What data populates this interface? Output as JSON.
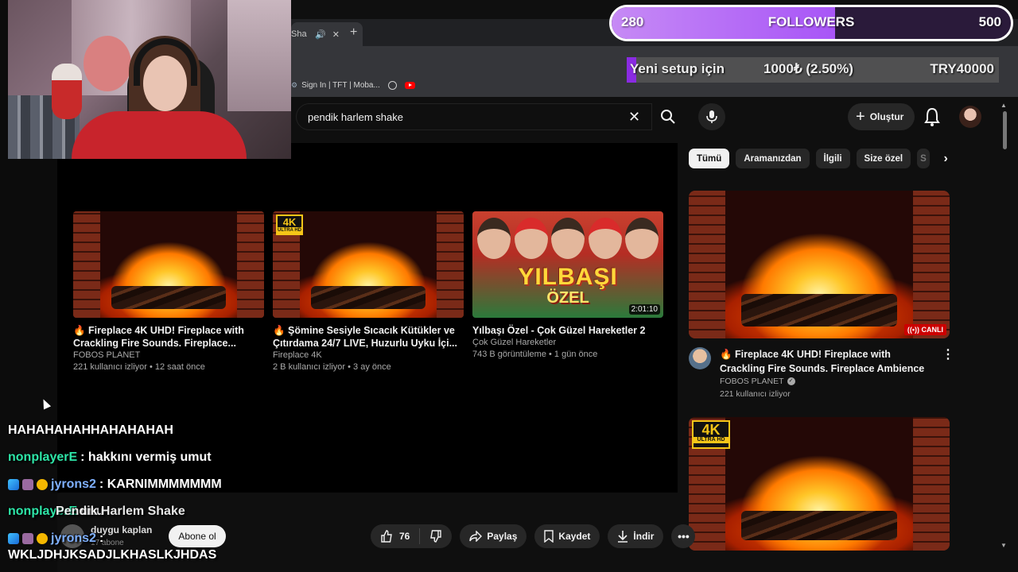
{
  "browser": {
    "tab_title": "Sha",
    "new_tab": "+",
    "bookmarks": [
      {
        "label": "Sign In | TFT | Moba..."
      }
    ]
  },
  "youtube": {
    "search_value": "pendik harlem shake",
    "create_label": "Oluştur",
    "chips": [
      "Tümü",
      "Aramanızdan",
      "İlgili",
      "Size özel",
      "S"
    ],
    "endcards": [
      {
        "title": "🔥 Fireplace 4K UHD! Fireplace with Crackling Fire Sounds. Fireplace...",
        "channel": "FOBOS PLANET",
        "meta": "221 kullanıcı izliyor • 12 saat önce"
      },
      {
        "title": "🔥 Şömine Sesiyle Sıcacık Kütükler ve Çıtırdama 24/7 LIVE, Huzurlu Uyku İçi...",
        "channel": "Fireplace 4K",
        "meta": "2 B kullanıcı izliyor • 3 ay önce",
        "badge_top": "4K",
        "badge_bottom": "ULTRA HD"
      },
      {
        "title": "Yılbaşı Özel - Çok Güzel Hareketler 2",
        "channel": "Çok Güzel Hareketler",
        "meta": "743 B görüntüleme • 1 gün önce",
        "duration": "2:01:10",
        "thumb_text_1": "YILBAŞI",
        "thumb_text_2": "ÖZEL"
      }
    ],
    "rail": {
      "item1": {
        "title": "🔥 Fireplace 4K UHD! Fireplace with Crackling Fire Sounds. Fireplace Ambience",
        "channel": "FOBOS PLANET",
        "meta": "221 kullanıcı izliyor",
        "live": "CANLI"
      },
      "item2": {
        "badge_top": "4K",
        "badge_bottom": "ULTRA HD"
      }
    },
    "watch": {
      "channel_name": "duygu kaplan",
      "subscribers": "17 abone",
      "subscribe_label": "Abone ol",
      "likes": "76",
      "share_label": "Paylaş",
      "save_label": "Kaydet",
      "download_label": "İndir"
    }
  },
  "overlay": {
    "followers_current": "280",
    "followers_label": "FOLLOWERS",
    "followers_goal": "500",
    "followers_progress": 0.56,
    "donation_label": "Yeni setup için",
    "donation_amount": "1000₺ (2.50%)",
    "donation_goal": "TRY40000",
    "donation_progress": 0.025
  },
  "chat": [
    {
      "user": "",
      "text": "HAHAHAHAHHAHAHAHAH"
    },
    {
      "user": "nonplayerE",
      "text": ": hakkını vermiş umut"
    },
    {
      "user": "jyrons2",
      "text": ": KARNIMMMMMMM"
    },
    {
      "user": "nonplayerE",
      "text": "unu",
      "overlay": "Pendik Harlem Shake"
    },
    {
      "user": "jyrons2",
      "text": ":"
    },
    {
      "user": "",
      "text": "WKLJDHJKSADJLKHASLKJHDAS"
    }
  ]
}
